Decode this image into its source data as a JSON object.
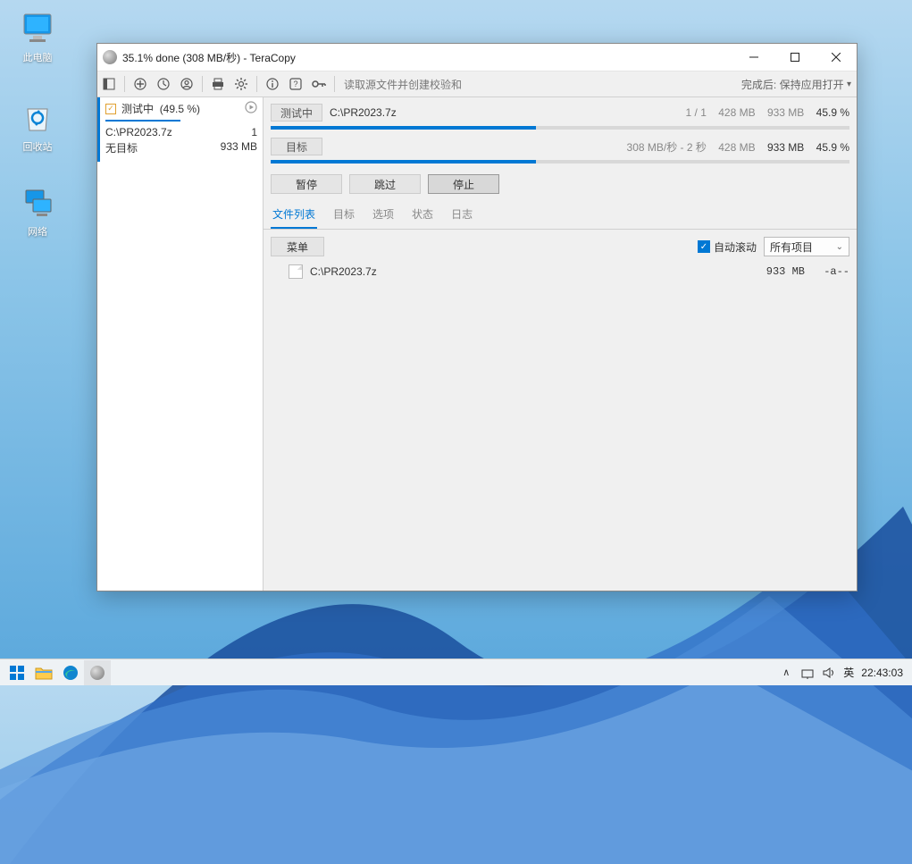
{
  "desktop": {
    "computer": "此电脑",
    "recycle": "回收站",
    "network": "网络"
  },
  "window": {
    "title": "35.1% done (308 MB/秒) - TeraCopy"
  },
  "toolbar": {
    "status": "读取源文件并创建校验和",
    "after_label": "完成后:",
    "after_value": "保持应用打开"
  },
  "task": {
    "status": "测试中",
    "percent": "(49.5 %)",
    "source": "C:\\PR2023.7z",
    "count": "1",
    "target": "无目标",
    "size": "933 MB"
  },
  "progress": {
    "row1": {
      "label": "测试中",
      "path": "C:\\PR2023.7z",
      "count": "1 / 1",
      "done": "428 MB",
      "total": "933 MB",
      "pct": "45.9 %",
      "fill": 45.9
    },
    "row2": {
      "label": "目标",
      "speed": "308 MB/秒 - 2 秒",
      "done": "428 MB",
      "total": "933 MB",
      "pct": "45.9 %",
      "fill": 45.9
    }
  },
  "actions": {
    "pause": "暂停",
    "skip": "跳过",
    "stop": "停止"
  },
  "tabs": {
    "filelist": "文件列表",
    "target": "目标",
    "options": "选项",
    "status": "状态",
    "log": "日志"
  },
  "listheader": {
    "menu": "菜单",
    "autoscroll": "自动滚动",
    "filter": "所有项目"
  },
  "files": {
    "0": {
      "name": "C:\\PR2023.7z",
      "size": "933  MB",
      "attr": "-a--"
    }
  },
  "tray": {
    "ime": "英",
    "time": "22:43:03"
  }
}
